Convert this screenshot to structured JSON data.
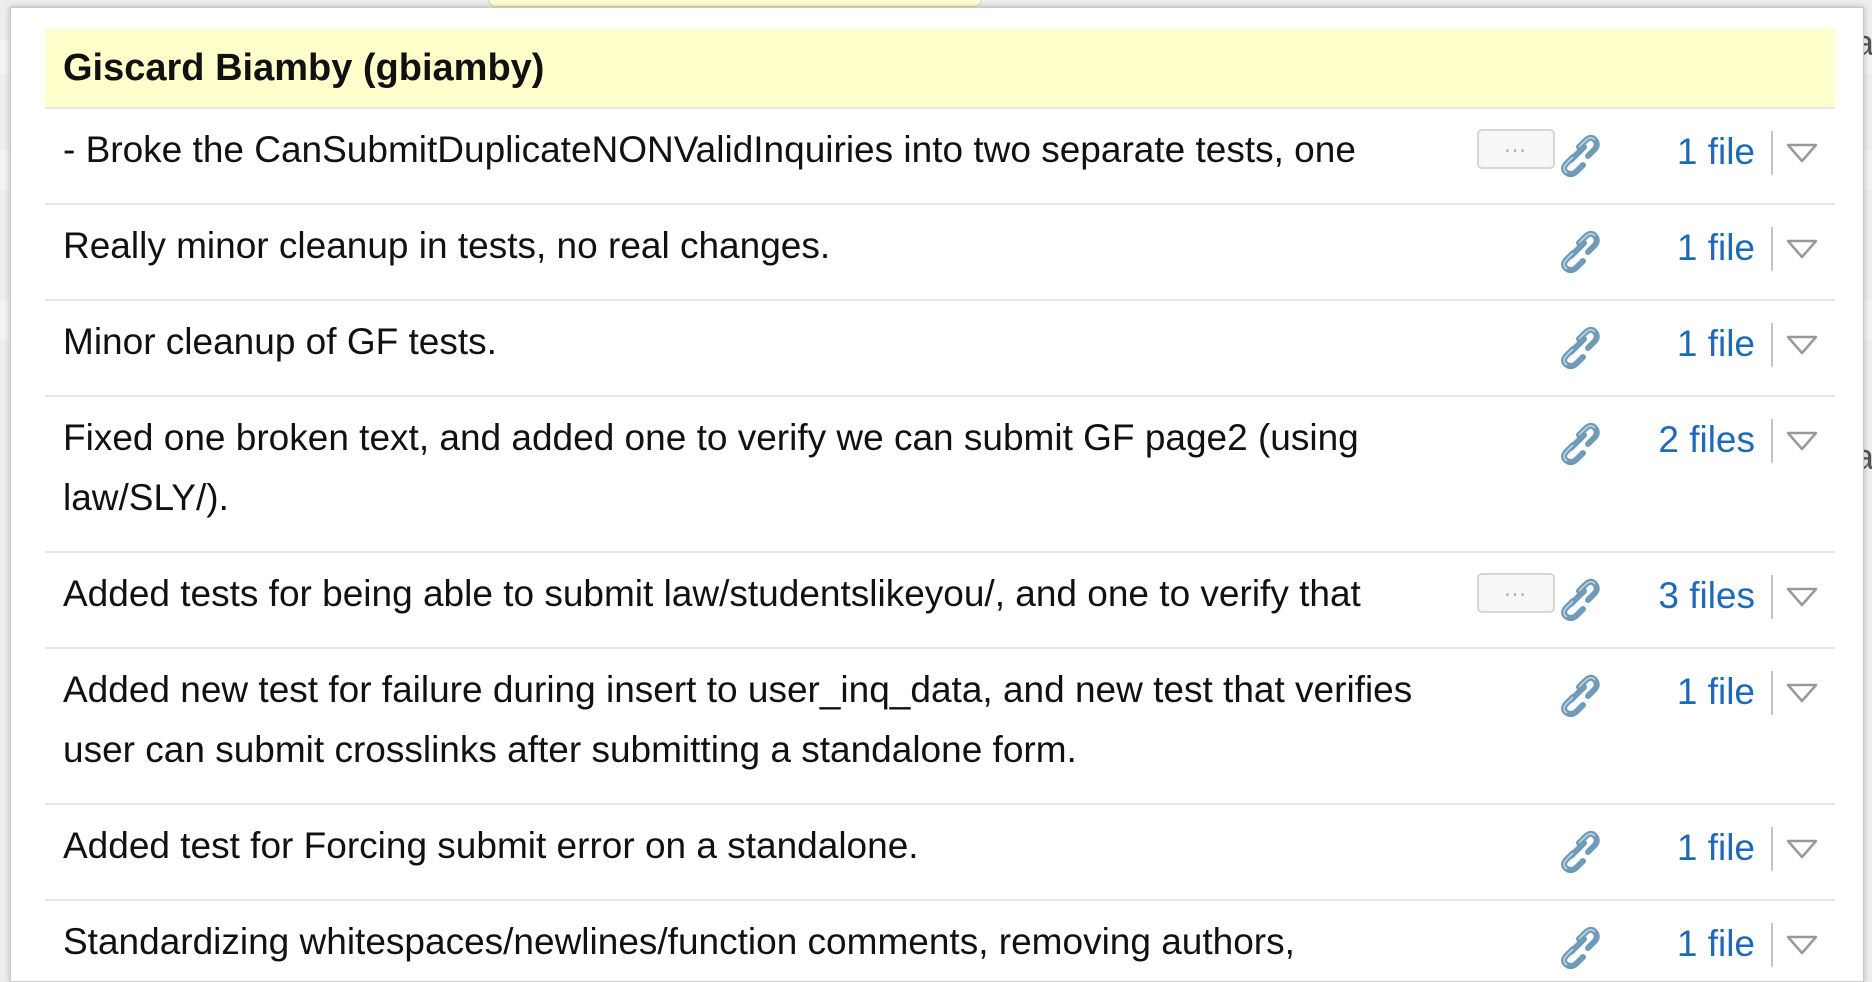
{
  "popup": {
    "author": "Giscard Biamby (gbiamby)",
    "more_label": "…",
    "commits": [
      {
        "message": "- Broke the CanSubmitDuplicateNONValidInquiries into two separate tests, one",
        "files": "1 file",
        "truncated": true
      },
      {
        "message": "Really minor cleanup in tests, no real changes.",
        "files": "1 file",
        "truncated": false
      },
      {
        "message": "Minor cleanup of GF tests.",
        "files": "1 file",
        "truncated": false
      },
      {
        "message": "Fixed one broken text, and added one to verify we can submit GF page2 (using\nlaw/SLY/).",
        "files": "2 files",
        "truncated": false
      },
      {
        "message": "Added tests for being able to submit law/studentslikeyou/, and one to verify that",
        "files": "3 files",
        "truncated": true
      },
      {
        "message": "Added new test for failure during insert to user_inq_data, and new test that verifies\nuser can submit crosslinks after submitting a standalone form.",
        "files": "1 file",
        "truncated": false
      },
      {
        "message": "Added test for Forcing submit error on a standalone.",
        "files": "1 file",
        "truncated": false
      },
      {
        "message": "Standardizing whitespaces/newlines/function comments, removing authors,",
        "files": "1 file",
        "truncated": false
      }
    ]
  },
  "background": {
    "edge_chars": [
      "a",
      "a"
    ]
  },
  "colors": {
    "author_bg": "#ffffcc",
    "link": "#1f6ab8",
    "icon": "#6f9bb8"
  }
}
